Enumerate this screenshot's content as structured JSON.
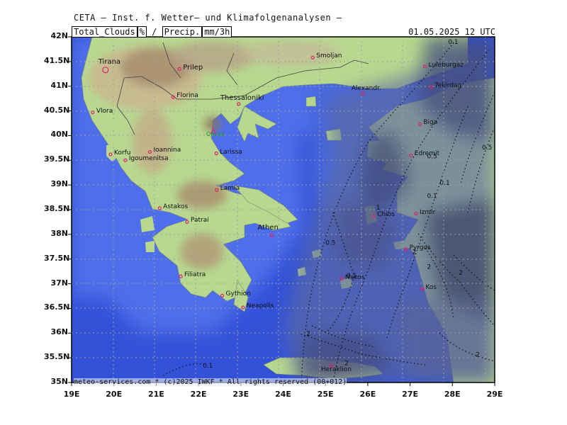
{
  "header": {
    "title": "CETA — Inst. f. Wetter— und Klimafolgenanalysen —",
    "field1": "Total_Clouds",
    "unit1": "%",
    "sep": "/",
    "field2": "Precip.",
    "unit2": "mm/3h",
    "valid": "01.05.2025 12 UTC"
  },
  "footer": "meteo-services.com * (c)2025 IWKF * All rights reserved (00+012)",
  "axes": {
    "lat_labels": [
      "42N",
      "41.5N",
      "41N",
      "40.5N",
      "40N",
      "39.5N",
      "39N",
      "38.5N",
      "38N",
      "37.5N",
      "37N",
      "36.5N",
      "36N",
      "35.5N",
      "35N"
    ],
    "lon_labels": [
      "19E",
      "20E",
      "21E",
      "22E",
      "23E",
      "24E",
      "25E",
      "26E",
      "27E",
      "28E",
      "29E"
    ]
  },
  "cities": [
    {
      "name": "Tirana",
      "lon": 19.8,
      "lat": 41.33
    },
    {
      "name": "Prilep",
      "lon": 21.55,
      "lat": 41.35
    },
    {
      "name": "Smoljan",
      "lon": 24.7,
      "lat": 41.58
    },
    {
      "name": "Luleburgaz",
      "lon": 27.35,
      "lat": 41.4
    },
    {
      "name": "Tekirdag",
      "lon": 27.5,
      "lat": 40.98
    },
    {
      "name": "Florina",
      "lon": 21.4,
      "lat": 40.78
    },
    {
      "name": "Alexandr.",
      "lon": 25.88,
      "lat": 40.85
    },
    {
      "name": "Thessaloniki",
      "lon": 22.95,
      "lat": 40.64
    },
    {
      "name": "Vlora",
      "lon": 19.5,
      "lat": 40.47
    },
    {
      "name": "Olymp",
      "lon": 22.35,
      "lat": 40.08
    },
    {
      "name": "Biga",
      "lon": 27.23,
      "lat": 40.23
    },
    {
      "name": "Korfu",
      "lon": 19.92,
      "lat": 39.62
    },
    {
      "name": "Ioannina",
      "lon": 20.85,
      "lat": 39.67
    },
    {
      "name": "Igoumenitsa",
      "lon": 20.27,
      "lat": 39.5
    },
    {
      "name": "Larissa",
      "lon": 22.42,
      "lat": 39.64
    },
    {
      "name": "Edremit",
      "lon": 27.02,
      "lat": 39.6
    },
    {
      "name": "Lamia",
      "lon": 22.43,
      "lat": 38.9
    },
    {
      "name": "Astakos",
      "lon": 21.08,
      "lat": 38.53
    },
    {
      "name": "Chios",
      "lon": 26.14,
      "lat": 38.37
    },
    {
      "name": "Izmir",
      "lon": 27.14,
      "lat": 38.42
    },
    {
      "name": "Patrai",
      "lon": 21.73,
      "lat": 38.25
    },
    {
      "name": "Athen",
      "lon": 23.73,
      "lat": 37.98
    },
    {
      "name": "Pyrgos",
      "lon": 26.9,
      "lat": 37.7
    },
    {
      "name": "Filiatra",
      "lon": 21.58,
      "lat": 37.15
    },
    {
      "name": "Naxos",
      "lon": 25.38,
      "lat": 37.1
    },
    {
      "name": "Gythion",
      "lon": 22.56,
      "lat": 36.76
    },
    {
      "name": "Kos",
      "lon": 27.28,
      "lat": 36.89
    },
    {
      "name": "Neapolis",
      "lon": 23.05,
      "lat": 36.52
    },
    {
      "name": "Heraklion",
      "lon": 25.13,
      "lat": 35.34
    }
  ],
  "contour_labels": [
    {
      "text": "0.1",
      "lon": 27.9,
      "lat": 41.86
    },
    {
      "text": "0.5",
      "lon": 28.7,
      "lat": 39.72
    },
    {
      "text": "0.5",
      "lon": 27.4,
      "lat": 39.54
    },
    {
      "text": "0.1",
      "lon": 27.7,
      "lat": 39.0
    },
    {
      "text": "0.1",
      "lon": 27.4,
      "lat": 38.74
    },
    {
      "text": "0.5",
      "lon": 25.0,
      "lat": 37.79
    },
    {
      "text": "0.5",
      "lon": 25.5,
      "lat": 37.12
    },
    {
      "text": "1",
      "lon": 26.2,
      "lat": 38.5
    },
    {
      "text": "2",
      "lon": 27.05,
      "lat": 37.6
    },
    {
      "text": "2",
      "lon": 27.4,
      "lat": 37.3
    },
    {
      "text": "2",
      "lon": 28.15,
      "lat": 37.18
    },
    {
      "text": "2",
      "lon": 24.55,
      "lat": 35.95
    },
    {
      "text": "2",
      "lon": 25.45,
      "lat": 35.35
    },
    {
      "text": "2",
      "lon": 28.55,
      "lat": 35.52
    },
    {
      "text": "0.1",
      "lon": 22.1,
      "lat": 35.3
    }
  ],
  "colors": {
    "sea": "#3452d8",
    "land_low": "#b8d890",
    "land_mid": "#c8b890",
    "land_high": "#9c8460",
    "cloud": "#5c6aa0",
    "city_marker": "#e0206a",
    "grid": "#a0a0a0"
  }
}
